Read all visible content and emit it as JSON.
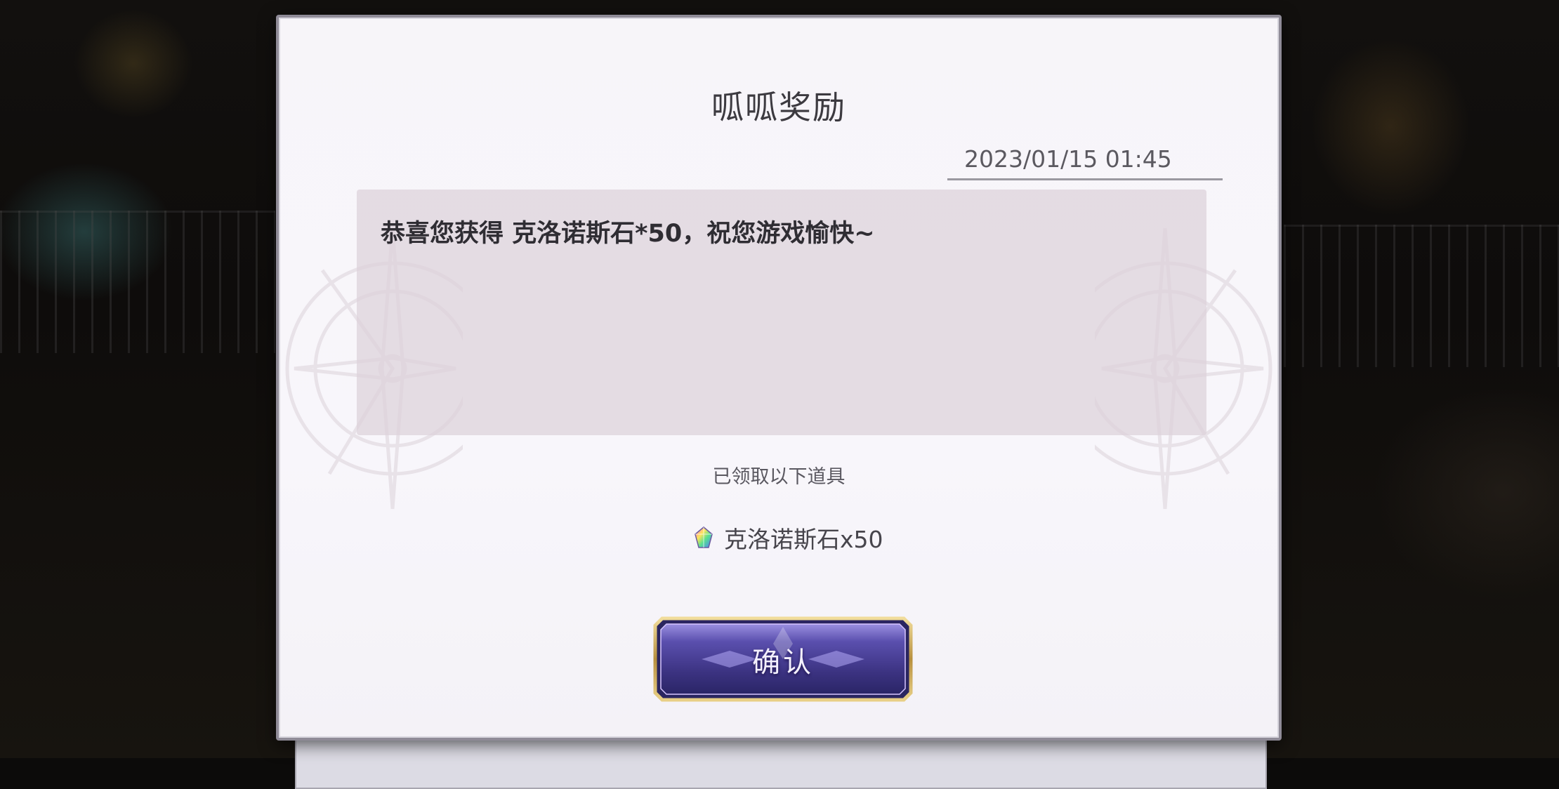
{
  "dialog": {
    "title": "呱呱奖励",
    "date": "2023/01/15 01:45",
    "message": "恭喜您获得 克洛诺斯石*50，祝您游戏愉快~",
    "claimed_label": "已领取以下道具",
    "reward": {
      "icon": "crystal-gem-icon",
      "label": "克洛诺斯石x50"
    },
    "confirm_label": "确认"
  },
  "colors": {
    "dialog_bg": "#f7f5f9",
    "message_bg": "#ddd1da",
    "button_purple": "#4a3f8f",
    "button_gold": "#c9a85a"
  }
}
